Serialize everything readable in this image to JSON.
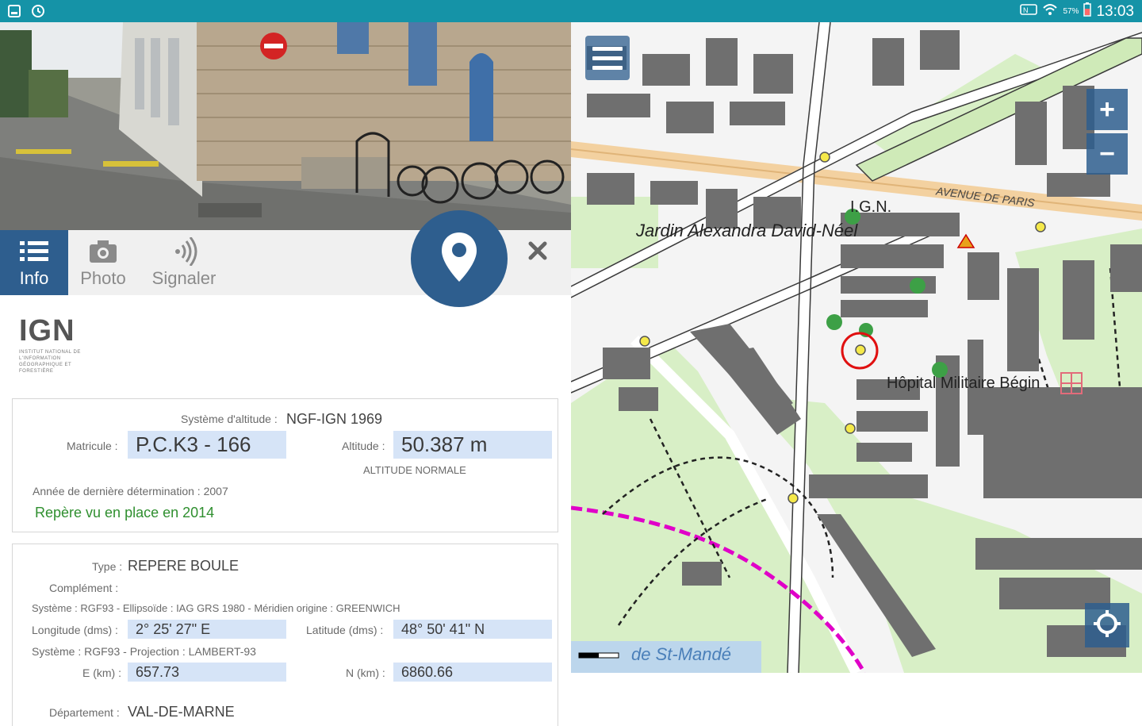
{
  "status_bar": {
    "time": "13:03",
    "battery": "57%",
    "left_icons": [
      "gallery-icon",
      "sync-icon"
    ],
    "right_icons": [
      "nfc-icon",
      "wifi-icon",
      "battery-icon"
    ]
  },
  "tabs": [
    {
      "label": "Info",
      "icon": "list-icon",
      "active": true
    },
    {
      "label": "Photo",
      "icon": "camera-icon",
      "active": false
    },
    {
      "label": "Signaler",
      "icon": "signal-icon",
      "active": false
    }
  ],
  "logo": {
    "text": "IGN",
    "subtitle": "INSTITUT NATIONAL DE L'INFORMATION GÉOGRAPHIQUE ET FORESTIÈRE"
  },
  "card1": {
    "systeme_label": "Système d'altitude :",
    "systeme_value": "NGF-IGN 1969",
    "matricule_label": "Matricule :",
    "matricule_value": "P.C.K3 - 166",
    "altitude_label": "Altitude :",
    "altitude_value": "50.387 m",
    "altitude_note": "ALTITUDE NORMALE",
    "annee_label": "Année de dernière détermination : 2007",
    "repere_text": "Repère vu en place en 2014"
  },
  "card2": {
    "type_label": "Type :",
    "type_value": "REPERE BOULE",
    "complement_label": "Complément :",
    "systeme1": "Système : RGF93 - Ellipsoïde : IAG GRS 1980 - Méridien origine : GREENWICH",
    "longitude_label": "Longitude (dms) :",
    "longitude_value": "2° 25' 27\" E",
    "latitude_label": "Latitude (dms) :",
    "latitude_value": "48° 50' 41\" N",
    "systeme2": "Système : RGF93 - Projection : LAMBERT-93",
    "e_label": "E (km) :",
    "e_value": "657.73",
    "n_label": "N (km) :",
    "n_value": "6860.66",
    "departement_label": "Département :",
    "departement_value": "VAL-DE-MARNE"
  },
  "map": {
    "labels": {
      "jardin": "Jardin Alexandra David-Néel",
      "ign": "I.G.N.",
      "avenue_paris": "AVENUE DE PARIS",
      "hopital": "Hôpital Militaire Bégin",
      "st_mande": "de St-Mandé"
    },
    "zoom_in": "+",
    "zoom_out": "−",
    "colors": {
      "green": "#d9f0c8",
      "building": "#6d6d6d",
      "road": "#ffffff",
      "rail": "#f3cf9b",
      "water": "#b9d3ea",
      "magenta": "#e000c8"
    }
  }
}
